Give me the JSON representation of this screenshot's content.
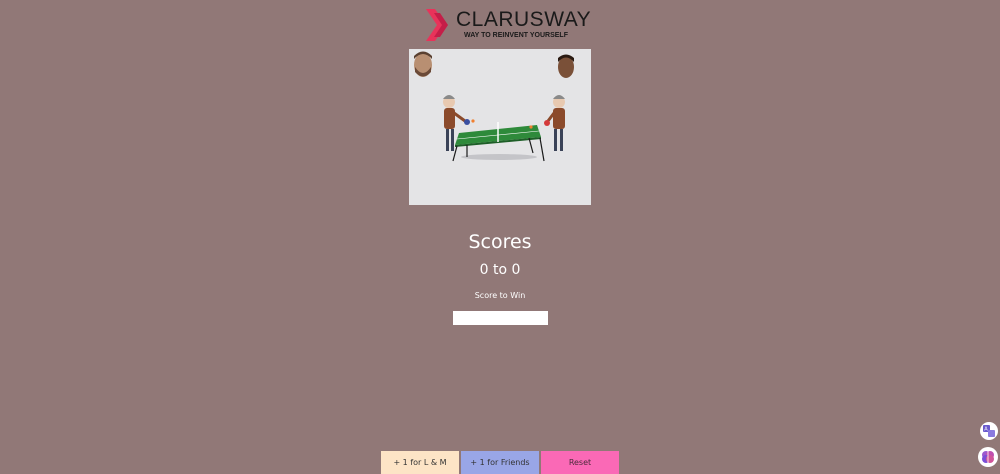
{
  "logo": {
    "name": "CLARUSWAY",
    "tagline": "WAY TO REINVENT YOURSELF",
    "mark_color": "#e8335a"
  },
  "game_image": {
    "description_icon": "ping-pong-illustration"
  },
  "scoreboard": {
    "title": "Scores",
    "score_text": "0 to 0",
    "win_label": "Score to Win",
    "win_input_value": ""
  },
  "buttons": {
    "lm_label": "+ 1 for L & M",
    "friends_label": "+ 1 for Friends",
    "reset_label": "Reset"
  },
  "colors": {
    "background": "#917877",
    "lm_button": "#fde4c6",
    "friends_button": "#99a6e6",
    "reset_button": "#fa69b6"
  },
  "extensions": {
    "translate_icon": "translate-icon",
    "brain_icon": "brain-icon"
  }
}
